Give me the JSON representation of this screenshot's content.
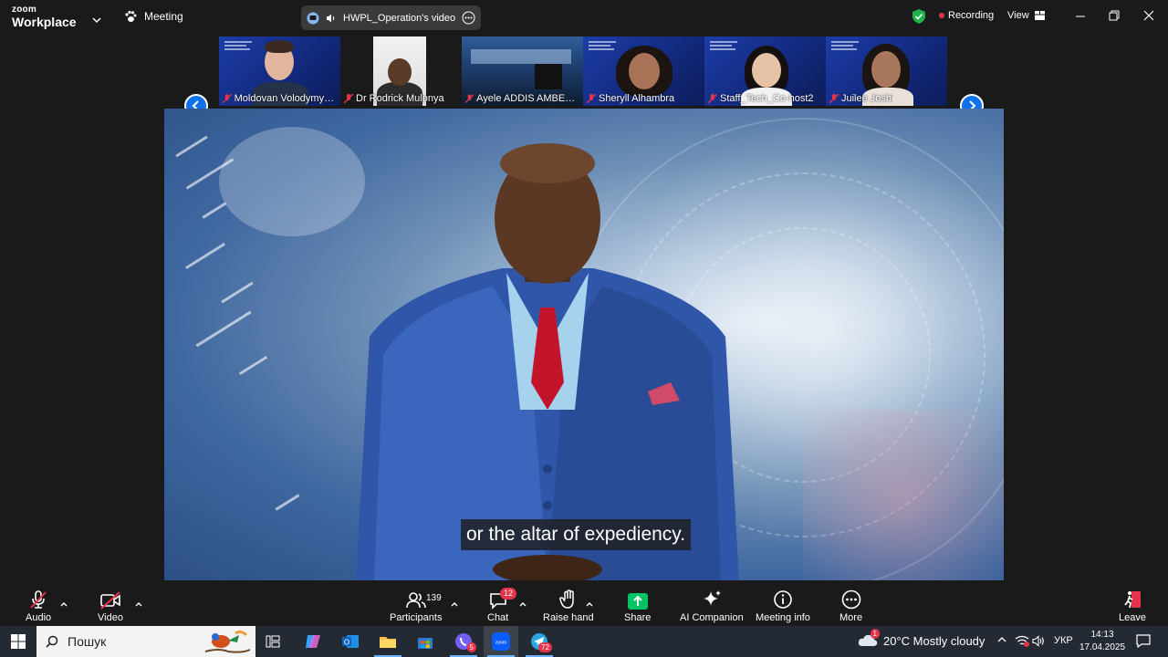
{
  "titlebar": {
    "logo_line1": "zoom",
    "logo_line2": "Workplace",
    "meeting_label": "Meeting",
    "share_title": "HWPL_Operation's video file",
    "recording_label": "Recording",
    "view_label": "View"
  },
  "participants_strip": [
    {
      "name": "Moldovan Volodymyr, ...",
      "muted": true
    },
    {
      "name": "Dr Rodrick Mulonya",
      "muted": true
    },
    {
      "name": "Ayele ADDIS AMBELU ...",
      "muted": true
    },
    {
      "name": "Sheryll Alhambra",
      "muted": true
    },
    {
      "name": "Staff_Tech_Co-host2",
      "muted": true
    },
    {
      "name": "Juilee Joshi",
      "muted": true
    }
  ],
  "video": {
    "caption": "or the altar of expediency."
  },
  "toolbar": {
    "audio_label": "Audio",
    "video_label": "Video",
    "participants_label": "Participants",
    "participants_count": "139",
    "chat_label": "Chat",
    "chat_badge": "12",
    "raise_hand_label": "Raise hand",
    "share_label": "Share",
    "ai_label": "AI Companion",
    "info_label": "Meeting info",
    "more_label": "More",
    "leave_label": "Leave"
  },
  "taskbar": {
    "search_placeholder": "Пошук",
    "viber_badge": "5",
    "telegram_badge": "72",
    "weather_badge": "1",
    "weather_text": "20°C  Mostly cloudy",
    "lang": "УКР",
    "time": "14:13",
    "date": "17.04.2025"
  },
  "colors": {
    "zoom_blue": "#0e72ed",
    "record_red": "#e5334a",
    "share_green": "#00c361",
    "shield_green": "#22b24c"
  }
}
